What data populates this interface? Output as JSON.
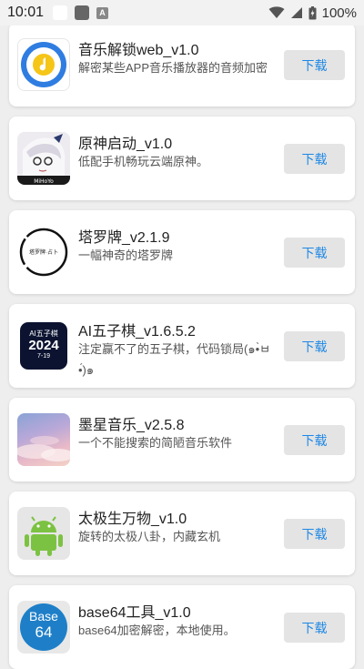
{
  "status_bar": {
    "time": "10:01",
    "battery": "100%"
  },
  "apps": [
    {
      "title": "音乐解锁web_v1.0",
      "desc": "解密某些APP音乐播放器的音频加密",
      "button": "下载",
      "icon": "music-unlock-icon"
    },
    {
      "title": "原神启动_v1.0",
      "desc": "低配手机畅玩云端原神。",
      "button": "下载",
      "icon": "genshin-character-icon"
    },
    {
      "title": "塔罗牌_v2.1.9",
      "desc": "一幅神奇的塔罗牌",
      "button": "下载",
      "icon": "tarot-circle-icon",
      "icon_text": "塔罗牌·占卜"
    },
    {
      "title": "AI五子棋_v1.6.5.2",
      "desc": "注定赢不了的五子棋，代码锁局(๑•̀ㅂ•́)๑",
      "button": "下载",
      "icon": "gomoku-icon",
      "icon_line1": "AI五子棋",
      "icon_line2": "2024",
      "icon_line3": "7-19"
    },
    {
      "title": "墨星音乐_v2.5.8",
      "desc": "一个不能搜索的简陋音乐软件",
      "button": "下载",
      "icon": "sky-cloud-icon"
    },
    {
      "title": "太极生万物_v1.0",
      "desc": "旋转的太极八卦，内藏玄机",
      "button": "下载",
      "icon": "android-icon"
    },
    {
      "title": "base64工具_v1.0",
      "desc": "base64加密解密，本地使用。",
      "button": "下载",
      "icon": "base64-icon",
      "icon_line1": "Base",
      "icon_line2": "64"
    }
  ]
}
